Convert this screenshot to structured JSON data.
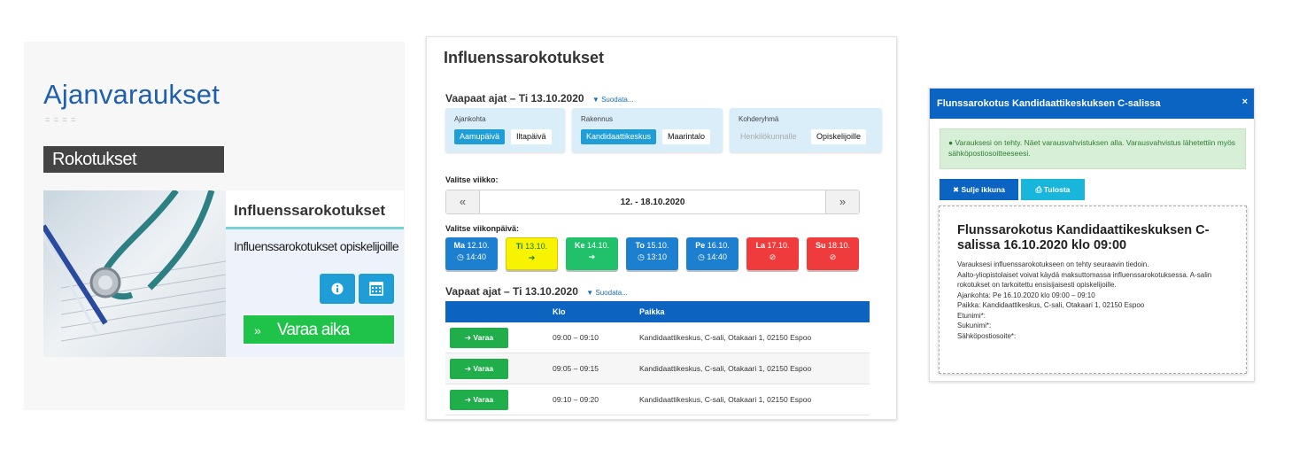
{
  "panel1": {
    "title": "Ajanvaraukset",
    "dots": "= = = =",
    "category_bar": "Rokotukset",
    "card_title": "Influenssarokotukset",
    "card_subtitle": "Influenssarokotukset opiskelijoille",
    "book_button": "Varaa aika",
    "icons": [
      "info-icon",
      "calendar-icon",
      "chevron-right-icon",
      "stethoscope-image"
    ],
    "colors": {
      "title": "#1e5fb0",
      "bar": "#444444",
      "button_blue": "#1f9dd6",
      "book_green": "#1fc34a"
    }
  },
  "panel2": {
    "title": "Influenssarokotukset",
    "free_times_heading": "Vaapaat ajat – Ti 13.10.2020",
    "filter_link": "Suodata...",
    "filters": [
      {
        "label": "Ajankohta",
        "options": [
          "Aamupäivä",
          "Iltapäivä"
        ],
        "selected": "Aamupäivä"
      },
      {
        "label": "Rakennus",
        "options": [
          "Kandidaattikeskus",
          "Maarintalo"
        ],
        "selected": "Kandidaattikeskus"
      },
      {
        "label": "Kohderyhmä",
        "options": [
          "Henkilökunnalle",
          "Opiskelijoille"
        ],
        "selected": "Opiskelijoille"
      }
    ],
    "week_label": "Valitse viikko:",
    "week_prev": "«",
    "week_range": "12. - 18.10.2020",
    "week_next": "»",
    "weekday_label": "Valitse viikonpäivä:",
    "days": [
      {
        "abbr": "Ma",
        "date": "12.10.",
        "sub": "14:40",
        "state": "blue",
        "sub_icon": "clock-icon"
      },
      {
        "abbr": "Ti",
        "date": "13.10.",
        "sub": "",
        "state": "yellow",
        "sub_icon": "arrow-right-icon"
      },
      {
        "abbr": "Ke",
        "date": "14.10.",
        "sub": "",
        "state": "green",
        "sub_icon": "arrow-right-icon"
      },
      {
        "abbr": "To",
        "date": "15.10.",
        "sub": "13:10",
        "state": "blue",
        "sub_icon": "clock-icon"
      },
      {
        "abbr": "Pe",
        "date": "16.10.",
        "sub": "14:40",
        "state": "blue",
        "sub_icon": "clock-icon"
      },
      {
        "abbr": "La",
        "date": "17.10.",
        "sub": "",
        "state": "red",
        "sub_icon": "ban-icon"
      },
      {
        "abbr": "Su",
        "date": "18.10.",
        "sub": "",
        "state": "red",
        "sub_icon": "ban-icon"
      }
    ],
    "table_heading": "Vapaat ajat – Ti 13.10.2020",
    "table_filter_link": "Suodata...",
    "columns": [
      "",
      "Klo",
      "Paikka"
    ],
    "rows": [
      {
        "button": "Varaa",
        "time": "09:00 – 09:10",
        "place": "Kandidaattikeskus, C-sali, Otakaari 1, 02150 Espoo"
      },
      {
        "button": "Varaa",
        "time": "09:05 – 09:15",
        "place": "Kandidaattikeskus, C-sali, Otakaari 1, 02150 Espoo"
      },
      {
        "button": "Varaa",
        "time": "09:10 – 09:20",
        "place": "Kandidaattikeskus, C-sali, Otakaari 1, 02150 Espoo"
      }
    ],
    "colors": {
      "table_header": "#0c64c0",
      "day_blue": "#1d7fcf",
      "day_yellow": "#f8f300",
      "day_green": "#21c06a",
      "day_red": "#ef3b3b",
      "varaa_green": "#1fae4a"
    }
  },
  "panel3": {
    "title": "Flunssarokotus Kandidaattikeskuksen C-salissa",
    "close": "×",
    "alert": "Varauksesi on tehty. Näet varausvahvistuksen alla. Varausvahvistus lähetettiin myös sähköpostiosoitteeseesi.",
    "close_window_button": "Sulje ikkuna",
    "print_button": "Tulosta",
    "card_title": "Flunssarokotus Kandidaattikeskuksen C-salissa 16.10.2020 klo 09:00",
    "card_lines": [
      "Varauksesi influenssarokotukseen on tehty seuraavin tiedoin.",
      "Aalto-yliopistolaiset voivat käydä maksuttomassa influenssarokotuksessa. A-salin rokotukset on tarkoitettu ensisijaisesti opiskelijoille.",
      "Ajankohta: Pe 16.10.2020 klo 09:00 – 09:10",
      "Paikka: Kandidaattikeskus, C-sali, Otakaari 1, 02150 Espoo",
      "Etunimi*:",
      "Sukunimi*:",
      "Sähköpostiosoite*:"
    ],
    "colors": {
      "header": "#0b64c1",
      "alert_bg": "#d6efd6",
      "print": "#19b6dc"
    }
  }
}
